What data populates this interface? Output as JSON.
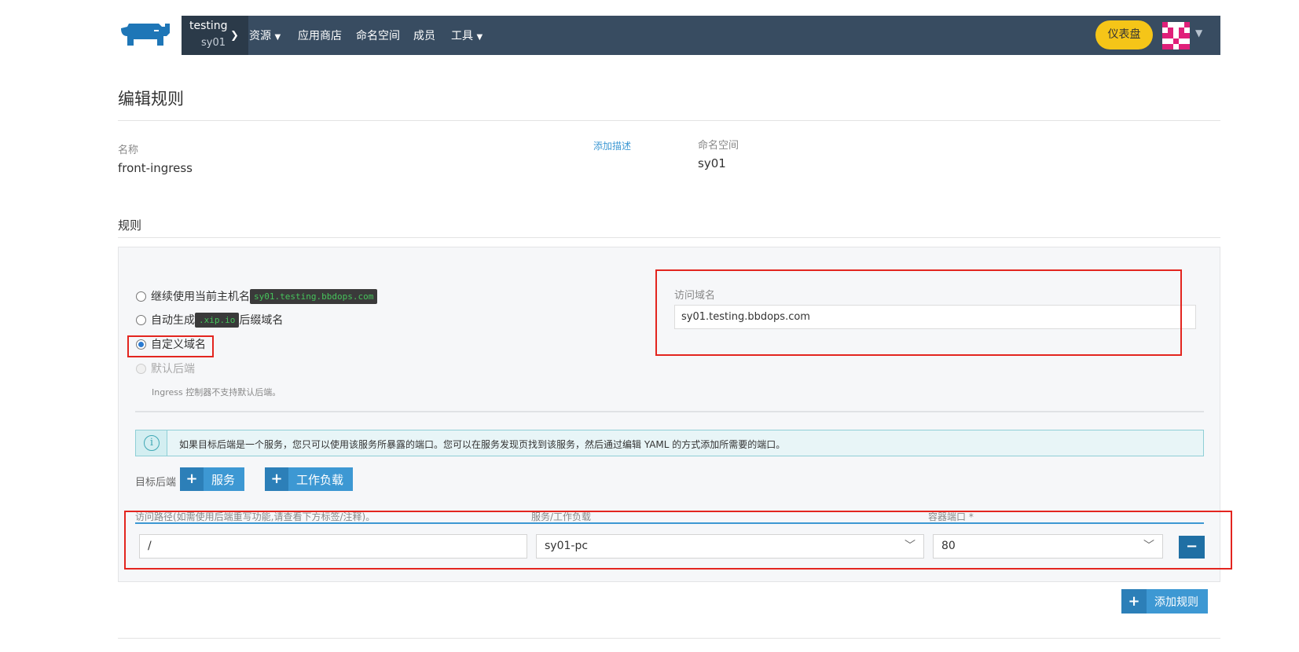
{
  "topbar": {
    "cluster_name": "testing",
    "project_name": "sy01",
    "nav": [
      "资源",
      "应用商店",
      "命名空间",
      "成员",
      "工具"
    ],
    "dashboard_label": "仪表盘",
    "bg_color": "#384c61",
    "accent_color": "#f5c518"
  },
  "page": {
    "title": "编辑规则",
    "name_label": "名称",
    "name_value": "front-ingress",
    "add_description": "添加描述",
    "namespace_label": "命名空间",
    "namespace_value": "sy01"
  },
  "rules": {
    "section_title": "规则",
    "options": {
      "current_host_pre": "继续使用当前主机名",
      "current_host_code": "sy01.testing.bbdops.com",
      "auto_pre": "自动生成",
      "auto_code": ".xip.io",
      "auto_post": "后缀域名",
      "custom": "自定义域名",
      "default_backend": "默认后端",
      "default_hint": "Ingress 控制器不支持默认后端。"
    },
    "selected_option": "custom",
    "domain_label": "访问域名",
    "domain_value": "sy01.testing.bbdops.com",
    "info_text": "如果目标后端是一个服务，您只可以使用该服务所暴露的端口。您可以在服务发现页找到该服务，然后通过编辑 YAML 的方式添加所需要的端口。",
    "target_label": "目标后端",
    "add_service": "服务",
    "add_workload": "工作负载",
    "columns": {
      "path": "访问路径(如需使用后端重写功能,请查看下方标签/注释)。",
      "service": "服务/工作负载",
      "port": "容器端口 *"
    },
    "row": {
      "path": "/",
      "service": "sy01-pc",
      "port": "80"
    },
    "add_rule": "添加规则"
  }
}
